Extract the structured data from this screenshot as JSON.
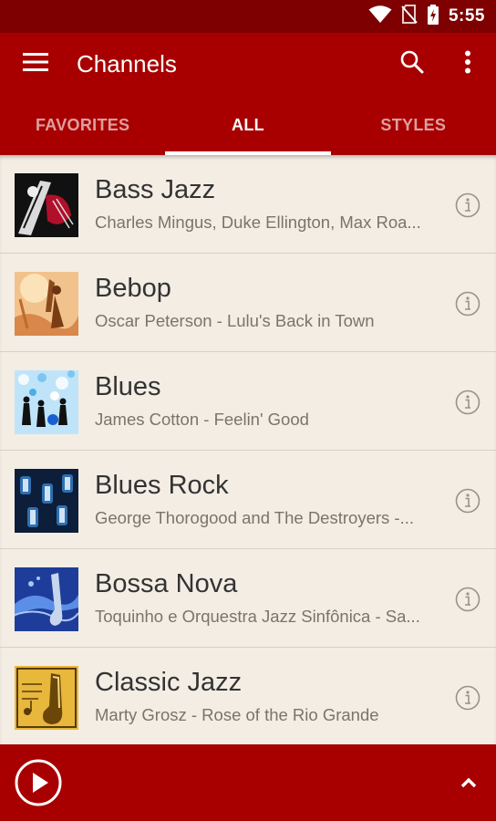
{
  "status_bar": {
    "time": "5:55",
    "icons": [
      "wifi-icon",
      "no-sim-icon",
      "battery-charging-icon"
    ]
  },
  "app_bar": {
    "title": "Channels",
    "icons": [
      "menu-icon",
      "search-icon",
      "more-vert-icon"
    ]
  },
  "tabs": [
    {
      "label": "FAVORITES",
      "active": false
    },
    {
      "label": "ALL",
      "active": true
    },
    {
      "label": "STYLES",
      "active": false
    }
  ],
  "channels": [
    {
      "name": "Bass Jazz",
      "subtitle": "Charles Mingus, Duke Ellington, Max Roa..."
    },
    {
      "name": "Bebop",
      "subtitle": "Oscar Peterson - Lulu's Back in Town"
    },
    {
      "name": "Blues",
      "subtitle": "James Cotton - Feelin' Good"
    },
    {
      "name": "Blues Rock",
      "subtitle": "George Thorogood and The Destroyers -..."
    },
    {
      "name": "Bossa Nova",
      "subtitle": "Toquinho e Orquestra Jazz Sinfônica - Sa..."
    },
    {
      "name": "Classic Jazz",
      "subtitle": "Marty Grosz - Rose of the Rio Grande"
    }
  ],
  "player": {
    "icons": [
      "play-icon",
      "chevron-up-icon"
    ]
  },
  "colors": {
    "status_bar": "#7e0000",
    "primary": "#a80000",
    "background": "#f3ede4",
    "title_text": "#333333",
    "subtitle_text": "#7b7468"
  }
}
